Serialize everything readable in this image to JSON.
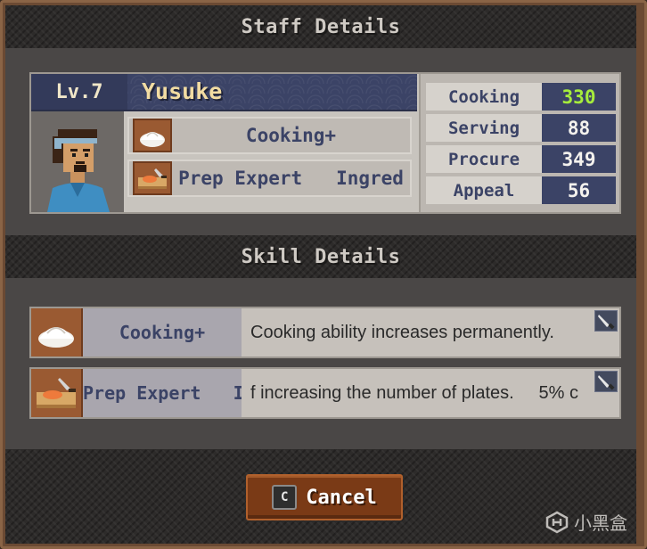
{
  "dialog": {
    "title": "Staff Details",
    "skill_section_title": "Skill Details"
  },
  "staff": {
    "level": "Lv.7",
    "name": "Yusuke",
    "traits": [
      {
        "label": "Cooking+",
        "icon": "bun-icon"
      },
      {
        "label": "Prep Expert   Ingred",
        "icon": "cutting-board-icon"
      }
    ],
    "stats": [
      {
        "label": "Cooking",
        "value": "330",
        "color": "#a6ec3c"
      },
      {
        "label": "Serving",
        "value": "88",
        "color": "#f4f2ee"
      },
      {
        "label": "Procure",
        "value": "349",
        "color": "#f4f2ee"
      },
      {
        "label": "Appeal",
        "value": "56",
        "color": "#f4f2ee"
      }
    ]
  },
  "skills": [
    {
      "name": "Cooking+",
      "description": "Cooking ability increases permanently.",
      "icon": "bun-icon",
      "badge_icon": "knife-icon"
    },
    {
      "name": "Prep Expert   In",
      "description": "f increasing the number of plates.     5% c",
      "icon": "cutting-board-icon",
      "badge_icon": "knife-icon"
    }
  ],
  "footer": {
    "key_hint": "C",
    "cancel_label": "Cancel"
  },
  "watermark": {
    "text": "小黑盒"
  },
  "colors": {
    "frame": "#6b4a33",
    "header_blue": "#3b4366",
    "highlight_green": "#a6ec3c",
    "button_brown": "#7a3a16"
  }
}
